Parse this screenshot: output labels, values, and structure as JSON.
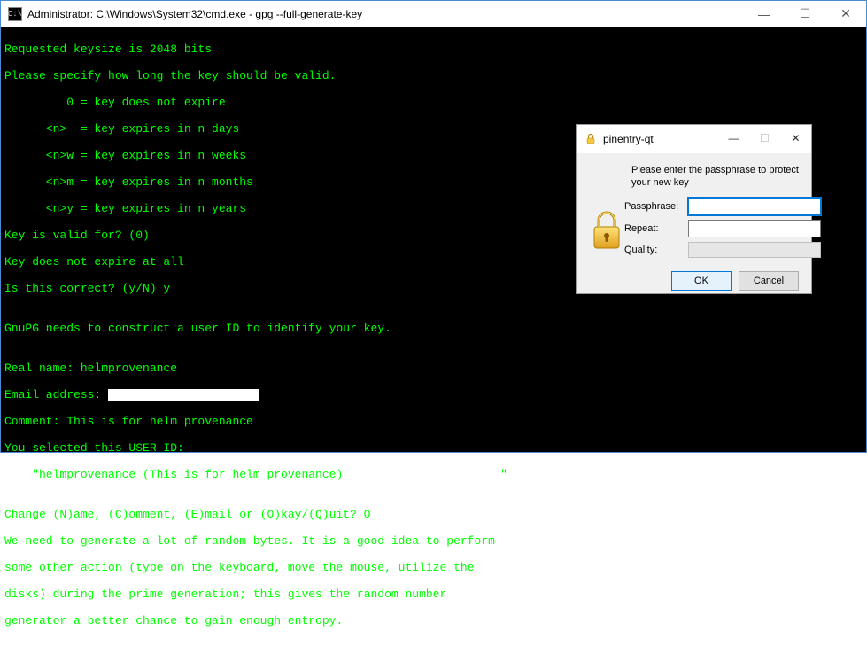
{
  "cmd": {
    "title": "Administrator: C:\\Windows\\System32\\cmd.exe - gpg  --full-generate-key",
    "icon_text": "C:\\",
    "lines": {
      "l00": "Requested keysize is 2048 bits",
      "l01": "Please specify how long the key should be valid.",
      "l02": "         0 = key does not expire",
      "l03": "      <n>  = key expires in n days",
      "l04": "      <n>w = key expires in n weeks",
      "l05": "      <n>m = key expires in n months",
      "l06": "      <n>y = key expires in n years",
      "l07": "Key is valid for? (0)",
      "l08": "Key does not expire at all",
      "l09": "Is this correct? (y/N) y",
      "l10": "",
      "l11": "GnuPG needs to construct a user ID to identify your key.",
      "l12": "",
      "l13": "Real name: helmprovenance",
      "l14_pre": "Email address: ",
      "l15": "Comment: This is for helm provenance",
      "l16": "You selected this USER-ID:",
      "l17_pre": "    \"helmprovenance (This is for helm provenance) ",
      "l17_post": "\"",
      "l18": "",
      "l19": "Change (N)ame, (C)omment, (E)mail or (O)kay/(Q)uit? O",
      "l20": "We need to generate a lot of random bytes. It is a good idea to perform",
      "l21": "some other action (type on the keyboard, move the mouse, utilize the",
      "l22": "disks) during the prime generation; this gives the random number",
      "l23": "generator a better chance to gain enough entropy."
    }
  },
  "pinentry": {
    "title": "pinentry-qt",
    "prompt": "Please enter the passphrase to protect your new key",
    "labels": {
      "passphrase": "Passphrase:",
      "repeat": "Repeat:",
      "quality": "Quality:"
    },
    "values": {
      "passphrase": "",
      "repeat": ""
    },
    "buttons": {
      "ok": "OK",
      "cancel": "Cancel"
    }
  },
  "controls": {
    "minimize": "—",
    "maximize": "☐",
    "close": "✕"
  }
}
